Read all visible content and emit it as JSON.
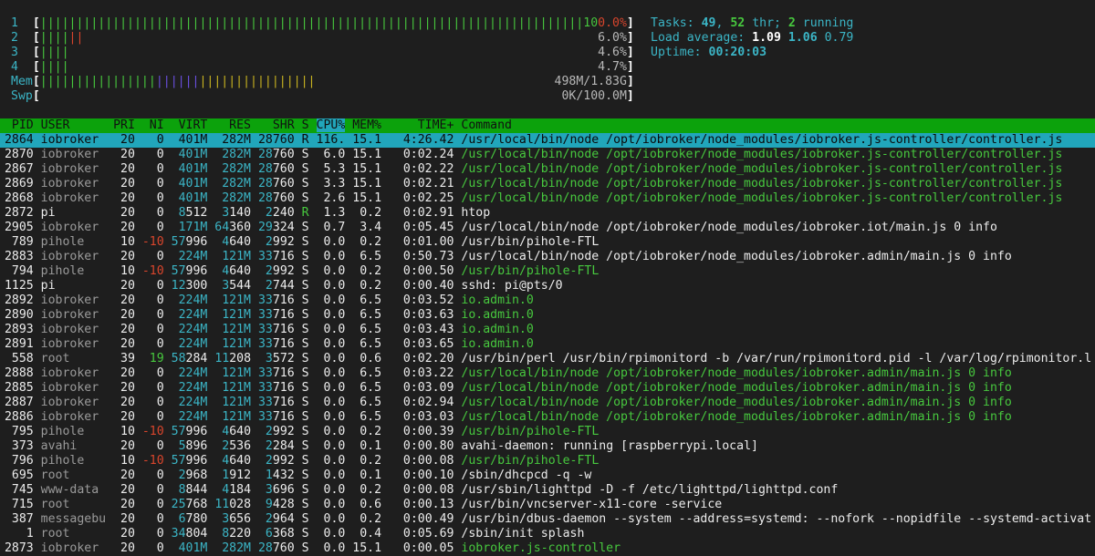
{
  "colors": {
    "background": "#1e1e1e",
    "header": "#0ca20c",
    "selected": "#21a6bb",
    "cyan": "#3bb5c6",
    "green": "#47c83e",
    "red": "#d9452c"
  },
  "meters": [
    {
      "label": "1",
      "value": "100.0%",
      "segments": [
        {
          "color": "green",
          "pct": 95
        },
        {
          "color": "red",
          "pct": 5
        }
      ]
    },
    {
      "label": "2",
      "value": "6.0%",
      "segments": [
        {
          "color": "green",
          "pct": 4.5
        },
        {
          "color": "red",
          "pct": 2.5
        }
      ]
    },
    {
      "label": "3",
      "value": "4.6%",
      "segments": [
        {
          "color": "green",
          "pct": 4.6
        }
      ]
    },
    {
      "label": "4",
      "value": "4.7%",
      "segments": [
        {
          "color": "green",
          "pct": 4.7
        }
      ]
    },
    {
      "label": "Mem",
      "value": "498M/1.83G",
      "segments": [
        {
          "color": "green",
          "pct": 20
        },
        {
          "color": "purple",
          "pct": 7.5
        },
        {
          "color": "yellow",
          "pct": 19.5
        }
      ]
    },
    {
      "label": "Swp",
      "value": "0K/100.0M",
      "segments": []
    }
  ],
  "summary": {
    "tasks_label": "Tasks: ",
    "tasks": "49",
    "sep": ", ",
    "threads": "52",
    "thr_label": " thr; ",
    "running": "2",
    "running_label": " running",
    "load_label": "Load average: ",
    "load1": "1.09",
    "load5": "1.06",
    "load15": "0.79",
    "uptime_label": "Uptime: ",
    "uptime": "00:20:03"
  },
  "columns": [
    "PID",
    "USER",
    "PRI",
    "NI",
    "VIRT",
    "RES",
    "SHR",
    "S",
    "CPU%",
    "MEM%",
    "TIME+",
    "Command"
  ],
  "sorted_column": "CPU%",
  "current_user": "pi",
  "processes": [
    {
      "pid": "2864",
      "user": "iobroker",
      "pri": "20",
      "ni": "0",
      "virt": "401M",
      "res": "282M",
      "shr": "28760",
      "s": "R",
      "cpu": "116.",
      "mem": "15.1",
      "time": "4:26.42",
      "cmd": "/usr/local/bin/node /opt/iobroker/node_modules/iobroker.js-controller/controller.js",
      "thread": false,
      "selected": true
    },
    {
      "pid": "2870",
      "user": "iobroker",
      "pri": "20",
      "ni": "0",
      "virt": "401M",
      "res": "282M",
      "shr": "28760",
      "s": "S",
      "cpu": "6.0",
      "mem": "15.1",
      "time": "0:02.24",
      "cmd": "/usr/local/bin/node /opt/iobroker/node_modules/iobroker.js-controller/controller.js",
      "thread": true
    },
    {
      "pid": "2867",
      "user": "iobroker",
      "pri": "20",
      "ni": "0",
      "virt": "401M",
      "res": "282M",
      "shr": "28760",
      "s": "S",
      "cpu": "5.3",
      "mem": "15.1",
      "time": "0:02.22",
      "cmd": "/usr/local/bin/node /opt/iobroker/node_modules/iobroker.js-controller/controller.js",
      "thread": true
    },
    {
      "pid": "2869",
      "user": "iobroker",
      "pri": "20",
      "ni": "0",
      "virt": "401M",
      "res": "282M",
      "shr": "28760",
      "s": "S",
      "cpu": "3.3",
      "mem": "15.1",
      "time": "0:02.21",
      "cmd": "/usr/local/bin/node /opt/iobroker/node_modules/iobroker.js-controller/controller.js",
      "thread": true
    },
    {
      "pid": "2868",
      "user": "iobroker",
      "pri": "20",
      "ni": "0",
      "virt": "401M",
      "res": "282M",
      "shr": "28760",
      "s": "S",
      "cpu": "2.6",
      "mem": "15.1",
      "time": "0:02.25",
      "cmd": "/usr/local/bin/node /opt/iobroker/node_modules/iobroker.js-controller/controller.js",
      "thread": true
    },
    {
      "pid": "2872",
      "user": "pi",
      "pri": "20",
      "ni": "0",
      "virt": "8512",
      "res": "3140",
      "shr": "2240",
      "s": "R",
      "cpu": "1.3",
      "mem": "0.2",
      "time": "0:02.91",
      "cmd": "htop",
      "thread": false
    },
    {
      "pid": "2905",
      "user": "iobroker",
      "pri": "20",
      "ni": "0",
      "virt": "171M",
      "res": "64360",
      "shr": "29324",
      "s": "S",
      "cpu": "0.7",
      "mem": "3.4",
      "time": "0:05.45",
      "cmd": "/usr/local/bin/node /opt/iobroker/node_modules/iobroker.iot/main.js 0 info",
      "thread": false
    },
    {
      "pid": "789",
      "user": "pihole",
      "pri": "10",
      "ni": "-10",
      "virt": "57996",
      "res": "4640",
      "shr": "2992",
      "s": "S",
      "cpu": "0.0",
      "mem": "0.2",
      "time": "0:01.00",
      "cmd": "/usr/bin/pihole-FTL",
      "thread": false
    },
    {
      "pid": "2883",
      "user": "iobroker",
      "pri": "20",
      "ni": "0",
      "virt": "224M",
      "res": "121M",
      "shr": "33716",
      "s": "S",
      "cpu": "0.0",
      "mem": "6.5",
      "time": "0:50.73",
      "cmd": "/usr/local/bin/node /opt/iobroker/node_modules/iobroker.admin/main.js 0 info",
      "thread": false
    },
    {
      "pid": "794",
      "user": "pihole",
      "pri": "10",
      "ni": "-10",
      "virt": "57996",
      "res": "4640",
      "shr": "2992",
      "s": "S",
      "cpu": "0.0",
      "mem": "0.2",
      "time": "0:00.50",
      "cmd": "/usr/bin/pihole-FTL",
      "thread": true
    },
    {
      "pid": "1125",
      "user": "pi",
      "pri": "20",
      "ni": "0",
      "virt": "12300",
      "res": "3544",
      "shr": "2744",
      "s": "S",
      "cpu": "0.0",
      "mem": "0.2",
      "time": "0:00.40",
      "cmd": "sshd: pi@pts/0",
      "thread": false
    },
    {
      "pid": "2892",
      "user": "iobroker",
      "pri": "20",
      "ni": "0",
      "virt": "224M",
      "res": "121M",
      "shr": "33716",
      "s": "S",
      "cpu": "0.0",
      "mem": "6.5",
      "time": "0:03.52",
      "cmd": "io.admin.0",
      "thread": true
    },
    {
      "pid": "2890",
      "user": "iobroker",
      "pri": "20",
      "ni": "0",
      "virt": "224M",
      "res": "121M",
      "shr": "33716",
      "s": "S",
      "cpu": "0.0",
      "mem": "6.5",
      "time": "0:03.63",
      "cmd": "io.admin.0",
      "thread": true
    },
    {
      "pid": "2893",
      "user": "iobroker",
      "pri": "20",
      "ni": "0",
      "virt": "224M",
      "res": "121M",
      "shr": "33716",
      "s": "S",
      "cpu": "0.0",
      "mem": "6.5",
      "time": "0:03.43",
      "cmd": "io.admin.0",
      "thread": true
    },
    {
      "pid": "2891",
      "user": "iobroker",
      "pri": "20",
      "ni": "0",
      "virt": "224M",
      "res": "121M",
      "shr": "33716",
      "s": "S",
      "cpu": "0.0",
      "mem": "6.5",
      "time": "0:03.65",
      "cmd": "io.admin.0",
      "thread": true
    },
    {
      "pid": "558",
      "user": "root",
      "pri": "39",
      "ni": "19",
      "virt": "58284",
      "res": "11208",
      "shr": "3572",
      "s": "S",
      "cpu": "0.0",
      "mem": "0.6",
      "time": "0:02.20",
      "cmd": "/usr/bin/perl /usr/bin/rpimonitord -b /var/run/rpimonitord.pid -l /var/log/rpimonitor.l",
      "thread": false
    },
    {
      "pid": "2888",
      "user": "iobroker",
      "pri": "20",
      "ni": "0",
      "virt": "224M",
      "res": "121M",
      "shr": "33716",
      "s": "S",
      "cpu": "0.0",
      "mem": "6.5",
      "time": "0:03.22",
      "cmd": "/usr/local/bin/node /opt/iobroker/node_modules/iobroker.admin/main.js 0 info",
      "thread": true
    },
    {
      "pid": "2885",
      "user": "iobroker",
      "pri": "20",
      "ni": "0",
      "virt": "224M",
      "res": "121M",
      "shr": "33716",
      "s": "S",
      "cpu": "0.0",
      "mem": "6.5",
      "time": "0:03.09",
      "cmd": "/usr/local/bin/node /opt/iobroker/node_modules/iobroker.admin/main.js 0 info",
      "thread": true
    },
    {
      "pid": "2887",
      "user": "iobroker",
      "pri": "20",
      "ni": "0",
      "virt": "224M",
      "res": "121M",
      "shr": "33716",
      "s": "S",
      "cpu": "0.0",
      "mem": "6.5",
      "time": "0:02.94",
      "cmd": "/usr/local/bin/node /opt/iobroker/node_modules/iobroker.admin/main.js 0 info",
      "thread": true
    },
    {
      "pid": "2886",
      "user": "iobroker",
      "pri": "20",
      "ni": "0",
      "virt": "224M",
      "res": "121M",
      "shr": "33716",
      "s": "S",
      "cpu": "0.0",
      "mem": "6.5",
      "time": "0:03.03",
      "cmd": "/usr/local/bin/node /opt/iobroker/node_modules/iobroker.admin/main.js 0 info",
      "thread": true
    },
    {
      "pid": "795",
      "user": "pihole",
      "pri": "10",
      "ni": "-10",
      "virt": "57996",
      "res": "4640",
      "shr": "2992",
      "s": "S",
      "cpu": "0.0",
      "mem": "0.2",
      "time": "0:00.39",
      "cmd": "/usr/bin/pihole-FTL",
      "thread": true
    },
    {
      "pid": "373",
      "user": "avahi",
      "pri": "20",
      "ni": "0",
      "virt": "5896",
      "res": "2536",
      "shr": "2284",
      "s": "S",
      "cpu": "0.0",
      "mem": "0.1",
      "time": "0:00.80",
      "cmd": "avahi-daemon: running [raspberrypi.local]",
      "thread": false
    },
    {
      "pid": "796",
      "user": "pihole",
      "pri": "10",
      "ni": "-10",
      "virt": "57996",
      "res": "4640",
      "shr": "2992",
      "s": "S",
      "cpu": "0.0",
      "mem": "0.2",
      "time": "0:00.08",
      "cmd": "/usr/bin/pihole-FTL",
      "thread": true
    },
    {
      "pid": "695",
      "user": "root",
      "pri": "20",
      "ni": "0",
      "virt": "2968",
      "res": "1912",
      "shr": "1432",
      "s": "S",
      "cpu": "0.0",
      "mem": "0.1",
      "time": "0:00.10",
      "cmd": "/sbin/dhcpcd -q -w",
      "thread": false
    },
    {
      "pid": "745",
      "user": "www-data",
      "pri": "20",
      "ni": "0",
      "virt": "8844",
      "res": "4184",
      "shr": "3696",
      "s": "S",
      "cpu": "0.0",
      "mem": "0.2",
      "time": "0:00.08",
      "cmd": "/usr/sbin/lighttpd -D -f /etc/lighttpd/lighttpd.conf",
      "thread": false
    },
    {
      "pid": "715",
      "user": "root",
      "pri": "20",
      "ni": "0",
      "virt": "25768",
      "res": "11028",
      "shr": "9428",
      "s": "S",
      "cpu": "0.0",
      "mem": "0.6",
      "time": "0:00.13",
      "cmd": "/usr/bin/vncserver-x11-core -service",
      "thread": false
    },
    {
      "pid": "387",
      "user": "messagebu",
      "pri": "20",
      "ni": "0",
      "virt": "6780",
      "res": "3656",
      "shr": "2964",
      "s": "S",
      "cpu": "0.0",
      "mem": "0.2",
      "time": "0:00.49",
      "cmd": "/usr/bin/dbus-daemon --system --address=systemd: --nofork --nopidfile --systemd-activat",
      "thread": false
    },
    {
      "pid": "1",
      "user": "root",
      "pri": "20",
      "ni": "0",
      "virt": "34804",
      "res": "8220",
      "shr": "6368",
      "s": "S",
      "cpu": "0.0",
      "mem": "0.4",
      "time": "0:05.69",
      "cmd": "/sbin/init splash",
      "thread": false
    },
    {
      "pid": "2873",
      "user": "iobroker",
      "pri": "20",
      "ni": "0",
      "virt": "401M",
      "res": "282M",
      "shr": "28760",
      "s": "S",
      "cpu": "0.0",
      "mem": "15.1",
      "time": "0:00.05",
      "cmd": "iobroker.js-controller",
      "thread": true
    }
  ]
}
